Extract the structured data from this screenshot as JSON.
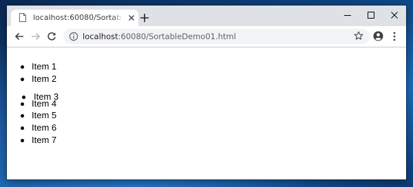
{
  "browser": {
    "tab": {
      "title": "localhost:60080/SortableDemo01.html"
    },
    "address_bar": {
      "host": "localhost",
      "path": ":60080/SortableDemo01.html"
    }
  },
  "page": {
    "items": [
      {
        "label": "Item 1"
      },
      {
        "label": "Item 2"
      },
      {
        "label": "Item 3"
      },
      {
        "label": "Item 4"
      },
      {
        "label": "Item 5"
      },
      {
        "label": "Item 6"
      },
      {
        "label": "Item 7"
      }
    ]
  }
}
